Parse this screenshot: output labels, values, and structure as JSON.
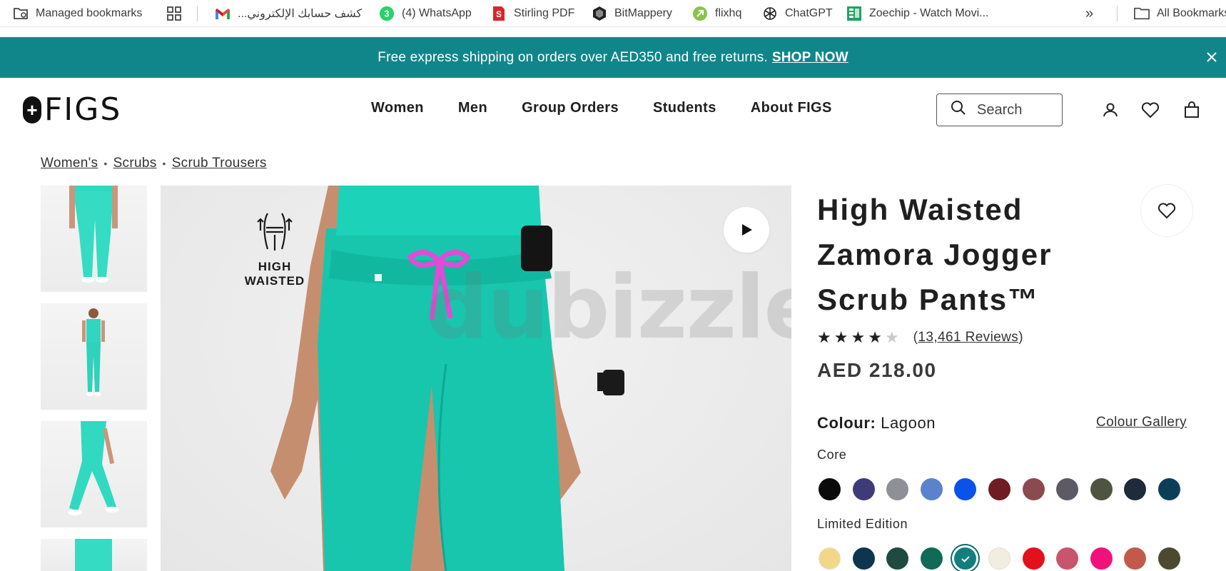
{
  "bookmarks": {
    "managed": "Managed bookmarks",
    "items": [
      {
        "label": "كشف حسابك الإلكتروني...",
        "icon": "gmail-icon"
      },
      {
        "label": "(4) WhatsApp",
        "icon": "whatsapp-icon",
        "badge": "3"
      },
      {
        "label": "Stirling PDF",
        "icon": "stirling-pdf-icon"
      },
      {
        "label": "BitMappery",
        "icon": "bitmappery-icon"
      },
      {
        "label": "flixhq",
        "icon": "flixhq-icon"
      },
      {
        "label": "ChatGPT",
        "icon": "chatgpt-icon"
      },
      {
        "label": "Zoechip - Watch Movi...",
        "icon": "zoechip-icon"
      }
    ],
    "more": "»",
    "all": "All Bookmarks"
  },
  "promo": {
    "text": "Free express shipping on orders over AED350 and free returns.",
    "link": "SHOP NOW",
    "color": "#11868a"
  },
  "header": {
    "logo_mark": "+",
    "logo_text": "FIGS",
    "nav": [
      "Women",
      "Men",
      "Group Orders",
      "Students",
      "About FIGS"
    ],
    "search_placeholder": "Search"
  },
  "breadcrumb": [
    "Women's",
    "Scrubs",
    "Scrub Trousers"
  ],
  "gallery": {
    "badge_line1": "HIGH",
    "badge_line2": "WAISTED",
    "watermark": "dubizzle"
  },
  "product": {
    "title": "High Waisted Zamora Jogger Scrub Pants™",
    "rating": 4.5,
    "stars": "★★★★★",
    "reviews": "13,461 Reviews",
    "price": "AED 218.00",
    "colour_label": "Colour:",
    "colour_value": "Lagoon",
    "colour_gallery": "Colour Gallery",
    "core_label": "Core",
    "limited_label": "Limited Edition",
    "core_swatches": [
      "#0a0a0a",
      "#3d3b78",
      "#8f8f97",
      "#5b82cc",
      "#0a52e8",
      "#6e1d22",
      "#8b4a4e",
      "#5d5a66",
      "#4f5442",
      "#1f2a3a",
      "#0d3e57"
    ],
    "limited_swatches": [
      "#f3d788",
      "#0e3550",
      "#1e4a3f",
      "#0f6b57",
      "#127f7d",
      "#f1eee0",
      "#e3101e",
      "#c8556b",
      "#f0127a",
      "#c25a4c",
      "#4b4a31"
    ],
    "selected_limited_index": 4
  }
}
